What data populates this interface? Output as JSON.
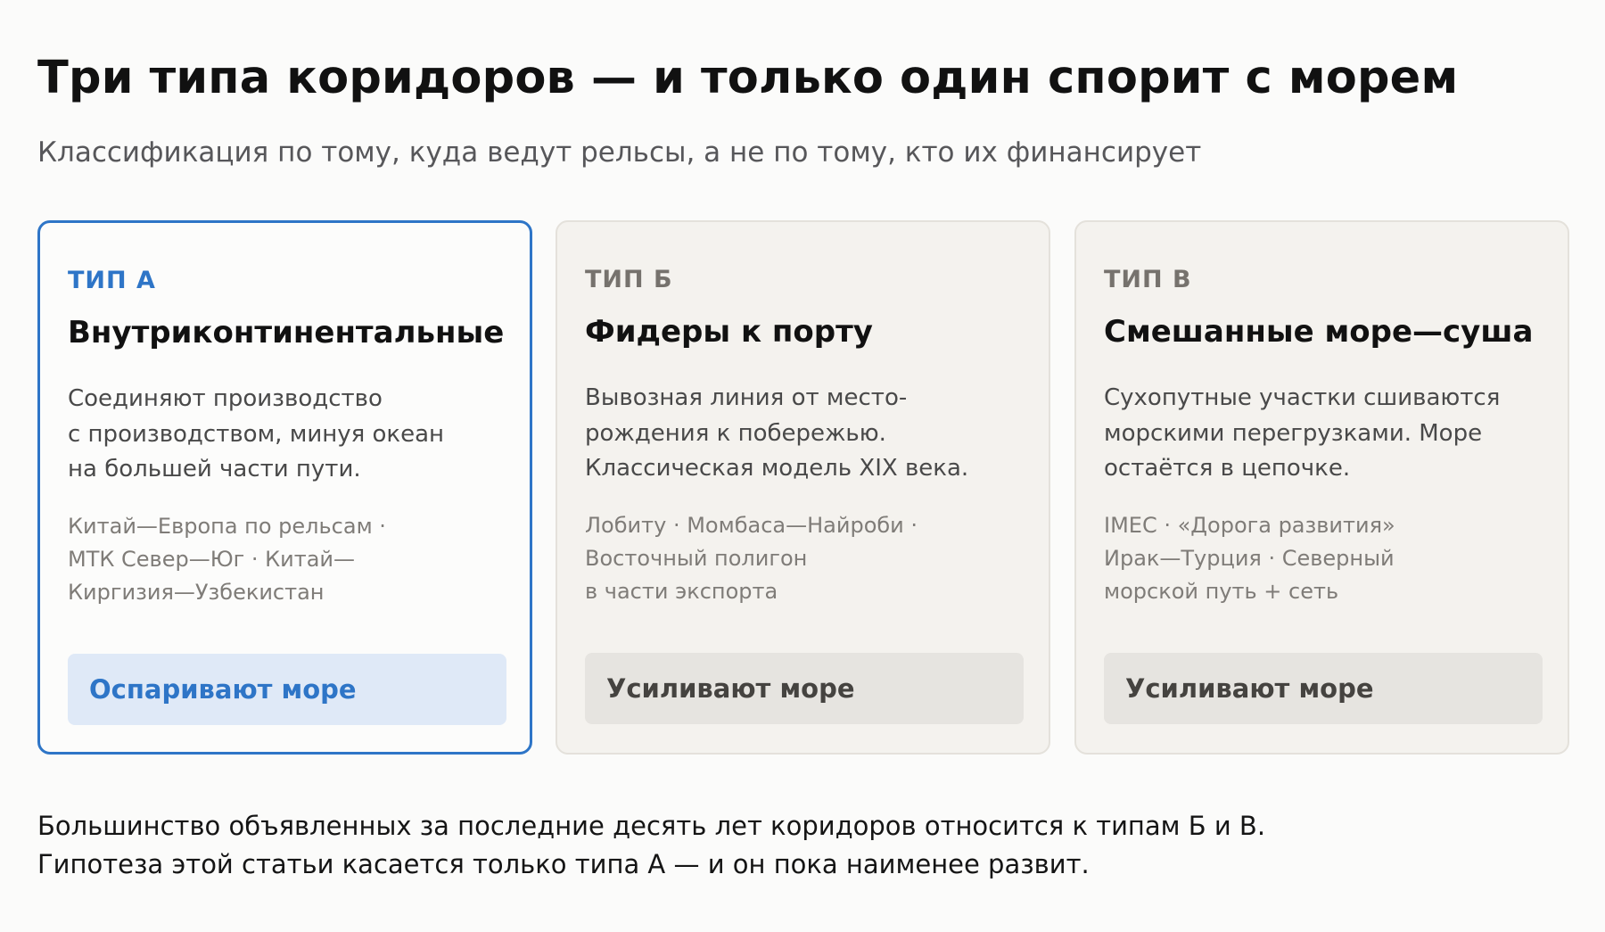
{
  "header": {
    "title": "Три типа коридоров — и только один спорит с морем",
    "subtitle": "Классификация по тому, куда ведут рельсы, а не по тому, кто их финансирует"
  },
  "cards": [
    {
      "tag": "ТИП А",
      "name": "Внутриконтинентальные",
      "description": "Соединяют производство\nс производством, минуя океан\nна большей части пути.",
      "examples": "Китай—Европа по рельсам ·\nМТК Север—Юг · Китай—\nКиргизия—Узбекистан",
      "badge": "Оспаривают море"
    },
    {
      "tag": "ТИП Б",
      "name": "Фидеры к порту",
      "description": "Вывозная линия от место-\nрождения к побережью.\nКлассическая модель XIX века.",
      "examples": "Лобиту · Момбаса—Найроби ·\nВосточный полигон\nв части экспорта",
      "badge": "Усиливают море"
    },
    {
      "tag": "ТИП В",
      "name": "Смешанные море—суша",
      "description": "Сухопутные участки сшиваются\nморскими перегрузками. Море\nостаётся в цепочке.",
      "examples": "IMEC · «Дорога развития»\nИрак—Турция · Северный\nморской путь + сеть",
      "badge": "Усиливают море"
    }
  ],
  "footer": {
    "line1": "Большинство объявленных за последние десять лет коридоров относится к типам Б и В.",
    "line2": "Гипотеза этой статьи касается только типа А — и он пока наименее развит."
  },
  "colors": {
    "accent": "#2e75c7",
    "accent_bg": "#dfe9f7",
    "card_bg": "#f4f2ee",
    "neutral_badge_bg": "#e6e4e0"
  }
}
